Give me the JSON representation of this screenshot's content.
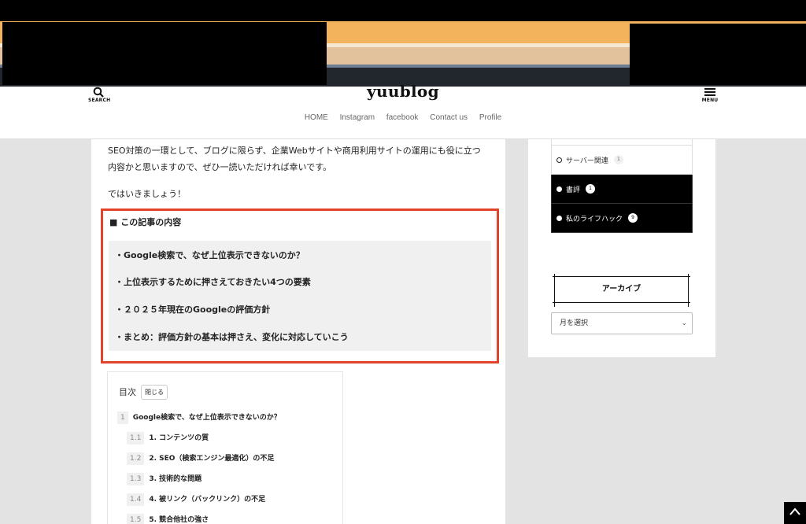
{
  "header": {
    "logo": "yuublog",
    "search_label": "SEARCH",
    "menu_label": "MENU",
    "nav": [
      "HOME",
      "Instagram",
      "facebook",
      "Contact us",
      "Profile"
    ]
  },
  "main": {
    "intro_lines": [
      "SEO対策の一環として、ブログに限らず、企業Webサイトや商用利用サイトの運用にも役に立つ",
      "内容かと思いますので、ぜひ一読いただければ幸いです。"
    ],
    "closing": "ではいきましょう！",
    "summary": {
      "title": "■ この記事の内容",
      "items": [
        "・Google検索で、なぜ上位表示できないのか？",
        "・上位表示するために押さえておきたい4つの要素",
        "・２０２５年現在のGoogleの評価方針",
        "・まとめ：評価方針の基本は押さえ、変化に対応していこう"
      ]
    },
    "toc": {
      "title": "目次",
      "close_label": "閉じる",
      "entries": [
        {
          "num": "1",
          "label": "Google検索で、なぜ上位表示できないのか？"
        },
        {
          "num": "1.1",
          "label": "1. コンテンツの質"
        },
        {
          "num": "1.2",
          "label": "2. SEO（検索エンジン最適化）の不足"
        },
        {
          "num": "1.3",
          "label": "3. 技術的な問題"
        },
        {
          "num": "1.4",
          "label": "4. 被リンク（バックリンク）の不足"
        },
        {
          "num": "1.5",
          "label": "5. 競合他社の強さ"
        }
      ]
    }
  },
  "sidebar": {
    "categories": [
      {
        "label": "サーバー関連",
        "count": "1",
        "style": "light"
      },
      {
        "label": "書評",
        "count": "1",
        "style": "dark"
      },
      {
        "label": "私のライフハック",
        "count": "9",
        "style": "dark"
      }
    ],
    "archive_title": "アーカイブ",
    "month_select": "月を選択"
  },
  "colors": {
    "summary_border": "#e0452b",
    "page_bg": "#e3e3e3"
  }
}
